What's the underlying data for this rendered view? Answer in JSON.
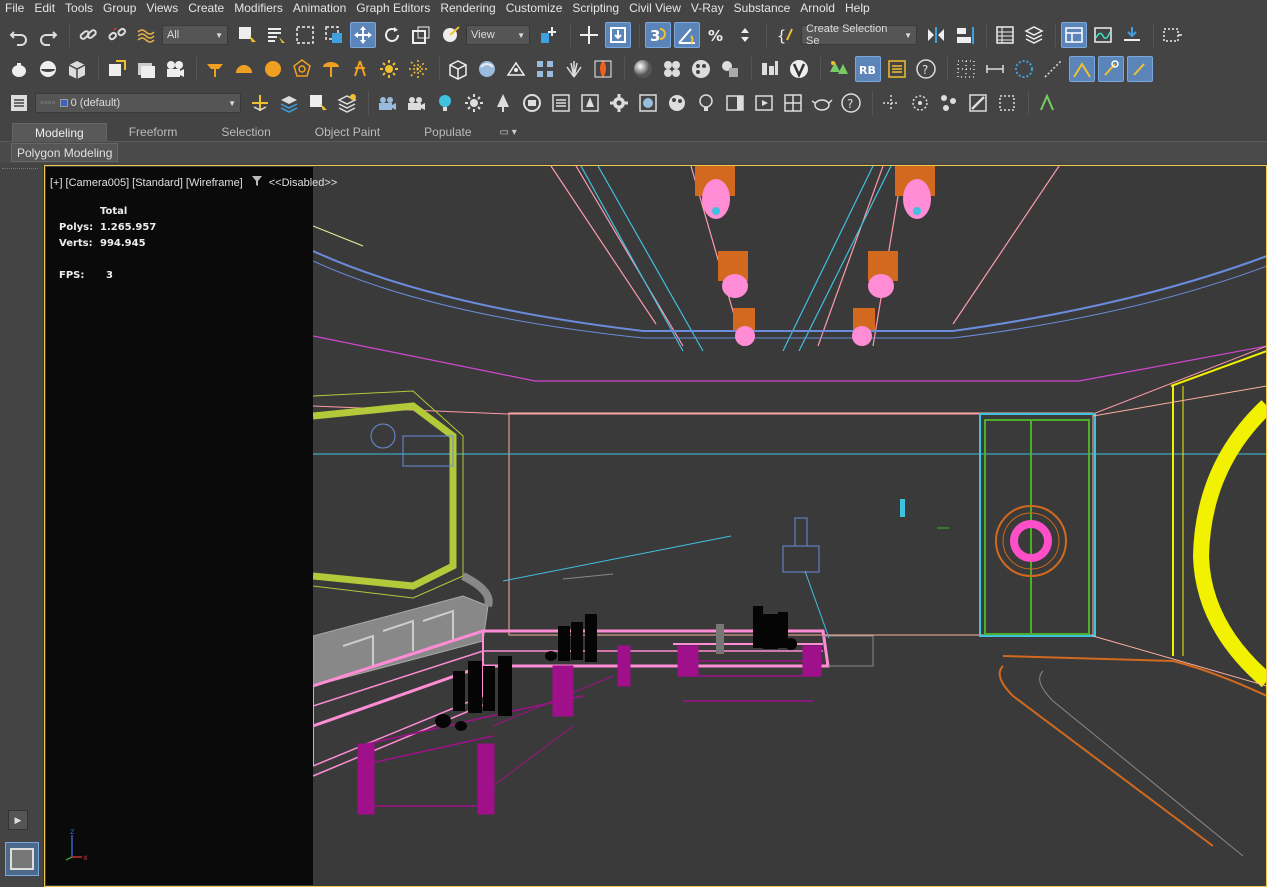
{
  "menu": [
    "File",
    "Edit",
    "Tools",
    "Group",
    "Views",
    "Create",
    "Modifiers",
    "Animation",
    "Graph Editors",
    "Rendering",
    "Customize",
    "Scripting",
    "Civil View",
    "V-Ray",
    "Substance",
    "Arnold",
    "Help"
  ],
  "toolbar": {
    "selection_filter": "All",
    "ref_coord": "View",
    "named_selection": "Create Selection Se",
    "layer": "0 (default)"
  },
  "ribbon": {
    "tabs": [
      "Modeling",
      "Freeform",
      "Selection",
      "Object Paint",
      "Populate"
    ],
    "active_tab": "Modeling",
    "panel_label": "Polygon Modeling"
  },
  "viewport": {
    "label_plus": "[+]",
    "label_camera": "[Camera005]",
    "label_standard": "[Standard]",
    "label_shading": "[Wireframe]",
    "label_status": "<<Disabled>>"
  },
  "stats": {
    "header": "Total",
    "polys_label": "Polys:",
    "polys_value": "1.265.957",
    "verts_label": "Verts:",
    "verts_value": "994.945",
    "fps_label": "FPS:",
    "fps_value": "3"
  },
  "axis": {
    "z": "z",
    "x": "x"
  },
  "colors": {
    "viewport_border": "#f2c84b",
    "selected_tool": "#5b84b8",
    "wire_pink": "#ff8cc8",
    "wire_magenta": "#a0108a",
    "wire_yellow": "#f2f200",
    "wire_cyan": "#3fc1e0",
    "wire_orange": "#d2691e"
  }
}
